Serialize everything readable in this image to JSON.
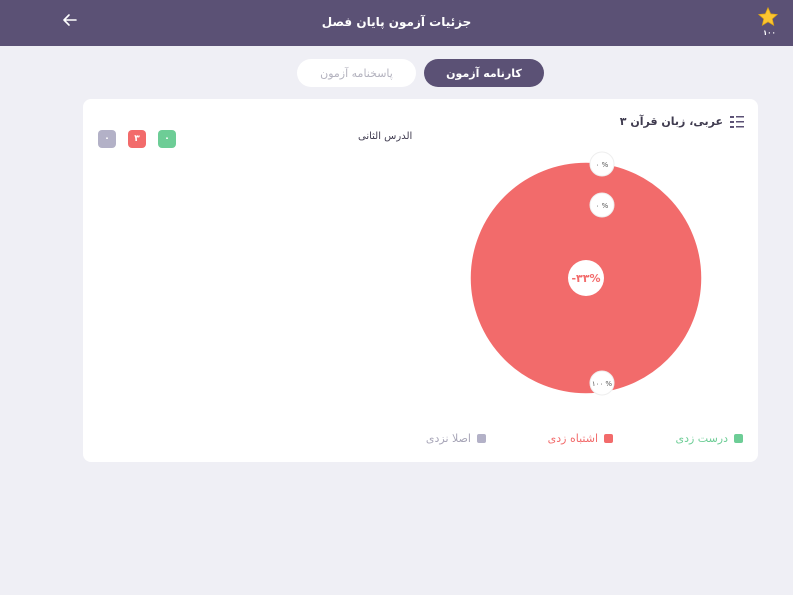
{
  "header": {
    "title": "جزئیات آزمون پایان فصل",
    "star_count": "۱۰۰"
  },
  "tabs": [
    {
      "label": "کارنامه آزمون",
      "active": true
    },
    {
      "label": "پاسخنامه آزمون",
      "active": false
    }
  ],
  "lesson": {
    "title": "عربی، زبان قرآن ۳",
    "subtitle": "الدرس الثانی"
  },
  "counts": {
    "correct": "۰",
    "wrong": "۳",
    "none": "۰"
  },
  "legend": {
    "correct": "درست زدی",
    "wrong": "اشتباه زدی",
    "none": "اصلا نزدی"
  },
  "colors": {
    "header": "#5b5175",
    "correct": "#6dcd96",
    "wrong": "#f26b6b",
    "none": "#b3b1c7"
  },
  "chart_data": {
    "type": "pie",
    "center_label": "-۳۳%",
    "slices": [
      {
        "name": "درست زدی",
        "value": 0,
        "label": "۰ %"
      },
      {
        "name": "اشتباه زدی",
        "value": 100,
        "label": "۱۰۰ %"
      },
      {
        "name": "اصلا نزدی",
        "value": 0,
        "label": "۰ %"
      }
    ]
  }
}
